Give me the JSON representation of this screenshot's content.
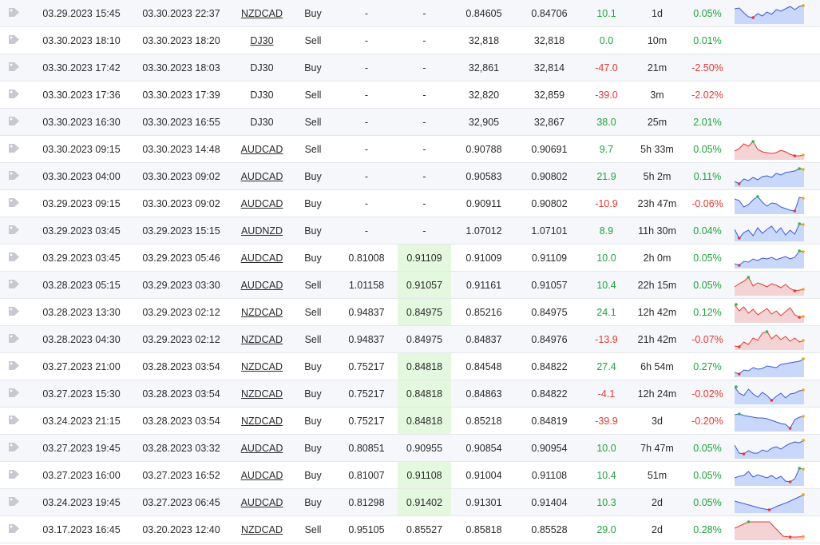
{
  "colors": {
    "profit": "#1fa33a",
    "loss": "#e53935",
    "tp_highlight": "#e4f7df",
    "spark_blue_line": "#3b5bd6",
    "spark_blue_fill": "#c9d7fb",
    "spark_red_line": "#e53935",
    "spark_red_fill": "#f3d3d3"
  },
  "icons": {
    "tag": "tag-icon"
  },
  "trades": [
    {
      "open": "03.29.2023 15:45",
      "close": "03.30.2023 22:37",
      "symbol": "NZDCAD",
      "link": true,
      "action": "Buy",
      "sl": "-",
      "tp": "-",
      "tp_hl": false,
      "open_price": "0.84605",
      "close_price": "0.84706",
      "pips": "10.1",
      "pips_sign": "pos",
      "duration": "1d",
      "gain": "0.05%",
      "gain_sign": "pos",
      "spark": {
        "type": "blue",
        "values": [
          0.8,
          0.85,
          0.55,
          0.3,
          0.25,
          0.5,
          0.35,
          0.6,
          0.45,
          0.75,
          0.65,
          0.8,
          0.95,
          0.75,
          0.95,
          1.0
        ]
      }
    },
    {
      "open": "03.30.2023 18:10",
      "close": "03.30.2023 18:20",
      "symbol": "DJ30",
      "link": true,
      "action": "Sell",
      "sl": "-",
      "tp": "-",
      "tp_hl": false,
      "open_price": "32,818",
      "close_price": "32,818",
      "pips": "0.0",
      "pips_sign": "pos",
      "duration": "10m",
      "gain": "0.01%",
      "gain_sign": "pos",
      "spark": null
    },
    {
      "open": "03.30.2023 17:42",
      "close": "03.30.2023 18:03",
      "symbol": "DJ30",
      "link": false,
      "action": "Buy",
      "sl": "-",
      "tp": "-",
      "tp_hl": false,
      "open_price": "32,861",
      "close_price": "32,814",
      "pips": "-47.0",
      "pips_sign": "neg",
      "duration": "21m",
      "gain": "-2.50%",
      "gain_sign": "neg",
      "spark": null
    },
    {
      "open": "03.30.2023 17:36",
      "close": "03.30.2023 17:39",
      "symbol": "DJ30",
      "link": false,
      "action": "Sell",
      "sl": "-",
      "tp": "-",
      "tp_hl": false,
      "open_price": "32,820",
      "close_price": "32,859",
      "pips": "-39.0",
      "pips_sign": "neg",
      "duration": "3m",
      "gain": "-2.02%",
      "gain_sign": "neg",
      "spark": null
    },
    {
      "open": "03.30.2023 16:30",
      "close": "03.30.2023 16:55",
      "symbol": "DJ30",
      "link": false,
      "action": "Sell",
      "sl": "-",
      "tp": "-",
      "tp_hl": false,
      "open_price": "32,905",
      "close_price": "32,867",
      "pips": "38.0",
      "pips_sign": "pos",
      "duration": "25m",
      "gain": "2.01%",
      "gain_sign": "pos",
      "spark": null
    },
    {
      "open": "03.30.2023 09:15",
      "close": "03.30.2023 14:48",
      "symbol": "AUDCAD",
      "link": true,
      "action": "Sell",
      "sl": "-",
      "tp": "-",
      "tp_hl": false,
      "open_price": "0.90788",
      "close_price": "0.90691",
      "pips": "9.7",
      "pips_sign": "pos",
      "duration": "5h 33m",
      "gain": "0.05%",
      "gain_sign": "pos",
      "spark": {
        "type": "red",
        "values": [
          0.4,
          0.55,
          0.85,
          0.7,
          1.0,
          0.5,
          0.35,
          0.3,
          0.25,
          0.3,
          0.45,
          0.35,
          0.2,
          0.1,
          0.1,
          0.15
        ]
      }
    },
    {
      "open": "03.30.2023 04:00",
      "close": "03.30.2023 09:02",
      "symbol": "AUDCAD",
      "link": true,
      "action": "Buy",
      "sl": "-",
      "tp": "-",
      "tp_hl": false,
      "open_price": "0.90583",
      "close_price": "0.90802",
      "pips": "21.9",
      "pips_sign": "pos",
      "duration": "5h 2m",
      "gain": "0.11%",
      "gain_sign": "pos",
      "spark": {
        "type": "blue",
        "values": [
          0.2,
          0.05,
          0.35,
          0.25,
          0.45,
          0.3,
          0.5,
          0.55,
          0.45,
          0.7,
          0.6,
          0.75,
          0.8,
          0.85,
          1.0,
          0.95
        ]
      }
    },
    {
      "open": "03.29.2023 09:15",
      "close": "03.30.2023 09:02",
      "symbol": "AUDCAD",
      "link": true,
      "action": "Buy",
      "sl": "-",
      "tp": "-",
      "tp_hl": false,
      "open_price": "0.90911",
      "close_price": "0.90802",
      "pips": "-10.9",
      "pips_sign": "neg",
      "duration": "23h 47m",
      "gain": "-0.06%",
      "gain_sign": "neg",
      "spark": {
        "type": "blue",
        "values": [
          0.8,
          0.7,
          0.3,
          0.45,
          0.75,
          0.95,
          0.6,
          0.35,
          0.55,
          0.5,
          0.3,
          0.2,
          0.1,
          0.05,
          0.9,
          0.85
        ]
      }
    },
    {
      "open": "03.29.2023 03:45",
      "close": "03.29.2023 15:15",
      "symbol": "AUDNZD",
      "link": true,
      "action": "Buy",
      "sl": "-",
      "tp": "-",
      "tp_hl": false,
      "open_price": "1.07012",
      "close_price": "1.07101",
      "pips": "8.9",
      "pips_sign": "pos",
      "duration": "11h 30m",
      "gain": "0.04%",
      "gain_sign": "pos",
      "spark": {
        "type": "blue",
        "values": [
          0.6,
          0.05,
          0.4,
          0.55,
          0.2,
          0.7,
          0.35,
          0.6,
          0.8,
          0.4,
          0.7,
          0.25,
          0.55,
          0.3,
          0.95,
          0.9
        ]
      }
    },
    {
      "open": "03.29.2023 03:45",
      "close": "03.29.2023 05:46",
      "symbol": "AUDCAD",
      "link": true,
      "action": "Buy",
      "sl": "0.81008",
      "tp": "0.91109",
      "tp_hl": true,
      "open_price": "0.91009",
      "close_price": "0.91109",
      "pips": "10.0",
      "pips_sign": "pos",
      "duration": "2h 0m",
      "gain": "0.05%",
      "gain_sign": "pos",
      "spark": {
        "type": "blue",
        "values": [
          0.15,
          0.05,
          0.3,
          0.25,
          0.45,
          0.35,
          0.5,
          0.45,
          0.55,
          0.4,
          0.5,
          0.6,
          0.45,
          0.55,
          0.95,
          0.9
        ]
      }
    },
    {
      "open": "03.28.2023 05:15",
      "close": "03.29.2023 03:30",
      "symbol": "AUDCAD",
      "link": true,
      "action": "Sell",
      "sl": "1.01158",
      "tp": "0.91057",
      "tp_hl": true,
      "open_price": "0.91161",
      "close_price": "0.91057",
      "pips": "10.4",
      "pips_sign": "pos",
      "duration": "22h 15m",
      "gain": "0.05%",
      "gain_sign": "pos",
      "spark": {
        "type": "red",
        "values": [
          0.4,
          0.6,
          0.75,
          1.0,
          0.45,
          0.65,
          0.55,
          0.4,
          0.6,
          0.5,
          0.35,
          0.55,
          0.3,
          0.15,
          0.2,
          0.25
        ]
      }
    },
    {
      "open": "03.28.2023 13:30",
      "close": "03.29.2023 02:12",
      "symbol": "NZDCAD",
      "link": true,
      "action": "Sell",
      "sl": "0.94837",
      "tp": "0.84975",
      "tp_hl": true,
      "open_price": "0.85216",
      "close_price": "0.84975",
      "pips": "24.1",
      "pips_sign": "pos",
      "duration": "12h 42m",
      "gain": "0.12%",
      "gain_sign": "pos",
      "spark": {
        "type": "red",
        "values": [
          1.0,
          0.6,
          0.85,
          0.45,
          0.7,
          0.35,
          0.55,
          0.75,
          0.4,
          0.6,
          0.3,
          0.55,
          0.8,
          0.35,
          0.2,
          0.25
        ]
      }
    },
    {
      "open": "03.28.2023 04:30",
      "close": "03.29.2023 02:12",
      "symbol": "NZDCAD",
      "link": true,
      "action": "Sell",
      "sl": "0.94837",
      "tp": "0.84975",
      "tp_hl": false,
      "open_price": "0.84837",
      "close_price": "0.84976",
      "pips": "-13.9",
      "pips_sign": "neg",
      "duration": "21h 42m",
      "gain": "-0.07%",
      "gain_sign": "neg",
      "spark": {
        "type": "red",
        "values": [
          0.1,
          0.05,
          0.35,
          0.2,
          0.6,
          0.45,
          0.9,
          1.0,
          0.55,
          0.8,
          0.5,
          0.7,
          0.4,
          0.6,
          0.35,
          0.45
        ]
      }
    },
    {
      "open": "03.27.2023 21:00",
      "close": "03.28.2023 03:54",
      "symbol": "NZDCAD",
      "link": true,
      "action": "Buy",
      "sl": "0.75217",
      "tp": "0.84818",
      "tp_hl": true,
      "open_price": "0.84548",
      "close_price": "0.84822",
      "pips": "27.4",
      "pips_sign": "pos",
      "duration": "6h 54m",
      "gain": "0.27%",
      "gain_sign": "pos",
      "spark": {
        "type": "blue",
        "values": [
          0.15,
          0.05,
          0.3,
          0.25,
          0.45,
          0.35,
          0.4,
          0.55,
          0.5,
          0.45,
          0.65,
          0.7,
          0.75,
          0.8,
          0.85,
          1.0
        ]
      }
    },
    {
      "open": "03.27.2023 15:30",
      "close": "03.28.2023 03:54",
      "symbol": "NZDCAD",
      "link": true,
      "action": "Buy",
      "sl": "0.75217",
      "tp": "0.84818",
      "tp_hl": true,
      "open_price": "0.84863",
      "close_price": "0.84822",
      "pips": "-4.1",
      "pips_sign": "neg",
      "duration": "12h 24m",
      "gain": "-0.02%",
      "gain_sign": "neg",
      "spark": {
        "type": "blue",
        "values": [
          0.95,
          0.55,
          0.4,
          0.8,
          0.5,
          0.3,
          0.6,
          0.4,
          0.1,
          0.35,
          0.55,
          0.25,
          0.5,
          0.55,
          0.7,
          0.75
        ]
      }
    },
    {
      "open": "03.24.2023 21:15",
      "close": "03.28.2023 03:54",
      "symbol": "NZDCAD",
      "link": true,
      "action": "Buy",
      "sl": "0.75217",
      "tp": "0.84818",
      "tp_hl": true,
      "open_price": "0.85218",
      "close_price": "0.84819",
      "pips": "-39.9",
      "pips_sign": "neg",
      "duration": "3d",
      "gain": "-0.20%",
      "gain_sign": "neg",
      "spark": {
        "type": "blue",
        "values": [
          0.9,
          0.95,
          0.85,
          0.8,
          0.75,
          0.7,
          0.7,
          0.65,
          0.55,
          0.45,
          0.35,
          0.3,
          0.05,
          0.6,
          0.75,
          0.8
        ]
      }
    },
    {
      "open": "03.27.2023 19:45",
      "close": "03.28.2023 03:32",
      "symbol": "AUDCAD",
      "link": true,
      "action": "Buy",
      "sl": "0.80851",
      "tp": "0.90955",
      "tp_hl": false,
      "open_price": "0.90854",
      "close_price": "0.90954",
      "pips": "10.0",
      "pips_sign": "pos",
      "duration": "7h 47m",
      "gain": "0.05%",
      "gain_sign": "pos",
      "spark": {
        "type": "blue",
        "values": [
          0.7,
          0.2,
          0.15,
          0.35,
          0.2,
          0.2,
          0.4,
          0.3,
          0.5,
          0.6,
          0.45,
          0.65,
          0.8,
          0.9,
          0.85,
          1.0
        ]
      }
    },
    {
      "open": "03.27.2023 16:00",
      "close": "03.27.2023 16:52",
      "symbol": "AUDCAD",
      "link": true,
      "action": "Buy",
      "sl": "0.81007",
      "tp": "0.91108",
      "tp_hl": true,
      "open_price": "0.91004",
      "close_price": "0.91108",
      "pips": "10.4",
      "pips_sign": "pos",
      "duration": "51m",
      "gain": "0.05%",
      "gain_sign": "pos",
      "spark": {
        "type": "blue",
        "values": [
          0.35,
          0.45,
          0.5,
          0.75,
          0.4,
          0.55,
          0.45,
          0.35,
          0.5,
          0.3,
          0.45,
          0.15,
          0.1,
          0.3,
          0.95,
          0.9
        ]
      }
    },
    {
      "open": "03.24.2023 19:45",
      "close": "03.27.2023 06:45",
      "symbol": "AUDCAD",
      "link": true,
      "action": "Buy",
      "sl": "0.81298",
      "tp": "0.91402",
      "tp_hl": true,
      "open_price": "0.91301",
      "close_price": "0.91404",
      "pips": "10.3",
      "pips_sign": "pos",
      "duration": "2d",
      "gain": "0.05%",
      "gain_sign": "pos",
      "spark": {
        "type": "blue",
        "values": [
          0.6,
          0.45,
          0.3,
          0.15,
          0.05,
          0.3,
          0.5,
          0.75,
          1.0
        ]
      }
    },
    {
      "open": "03.17.2023 16:45",
      "close": "03.20.2023 12:40",
      "symbol": "NZDCAD",
      "link": true,
      "action": "Sell",
      "sl": "0.95105",
      "tp": "0.85527",
      "tp_hl": false,
      "open_price": "0.85818",
      "close_price": "0.85528",
      "pips": "29.0",
      "pips_sign": "pos",
      "duration": "2d",
      "gain": "0.28%",
      "gain_sign": "pos",
      "spark": {
        "type": "red",
        "values": [
          0.6,
          0.8,
          1.0,
          1.0,
          1.0,
          1.0,
          0.55,
          0.1,
          0.05,
          0.05,
          0.08
        ]
      }
    }
  ]
}
